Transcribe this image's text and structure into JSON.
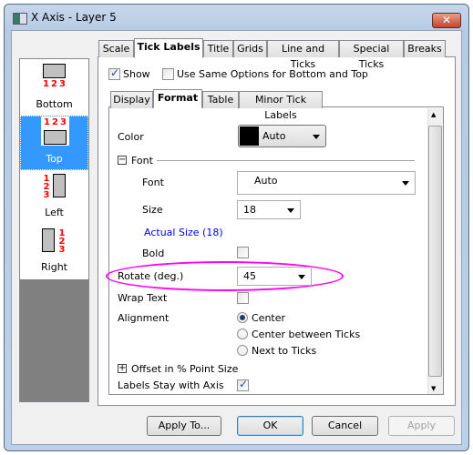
{
  "window": {
    "title": "X Axis - Layer 5",
    "close_icon": "close-icon"
  },
  "axis_list": [
    {
      "label": "Bottom",
      "selected": false
    },
    {
      "label": "Top",
      "selected": true
    },
    {
      "label": "Left",
      "selected": false
    },
    {
      "label": "Right",
      "selected": false
    }
  ],
  "tick_nums": [
    "1",
    "2",
    "3"
  ],
  "tabs": [
    "Scale",
    "Tick Labels",
    "Title",
    "Grids",
    "Line and Ticks",
    "Special Ticks",
    "Breaks"
  ],
  "active_tab": "Tick Labels",
  "show": {
    "label": "Show",
    "checked": true
  },
  "use_same": {
    "label": "Use Same Options for Bottom and Top",
    "checked": false
  },
  "subtabs": [
    "Display",
    "Format",
    "Table",
    "Minor Tick Labels"
  ],
  "active_subtab": "Format",
  "format": {
    "color_label": "Color",
    "color_value": "Auto",
    "color_swatch": "#000000",
    "font_section": "Font",
    "font_label": "Font",
    "font_value": "Auto",
    "size_label": "Size",
    "size_value": "18",
    "actual_size": "Actual Size (18)",
    "bold_label": "Bold",
    "bold_checked": false,
    "rotate_label": "Rotate (deg.)",
    "rotate_value": "45",
    "wrap_label": "Wrap Text",
    "wrap_checked": false,
    "alignment_label": "Alignment",
    "alignment_options": [
      "Center",
      "Center between Ticks",
      "Next to Ticks"
    ],
    "alignment_selected": "Center",
    "offset_section": "Offset in % Point Size",
    "stay_label": "Labels Stay with Axis",
    "stay_checked": true
  },
  "highlight_color": "#ff00ff",
  "buttons": {
    "apply_to": "Apply To...",
    "ok": "OK",
    "cancel": "Cancel",
    "apply": "Apply"
  }
}
